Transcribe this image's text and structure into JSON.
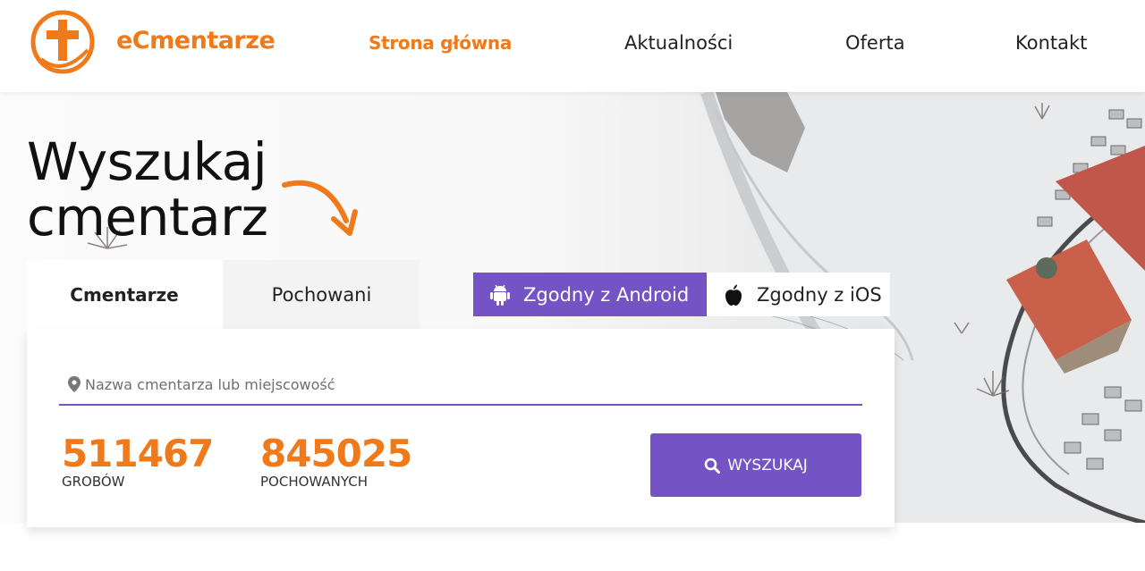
{
  "brand": {
    "name": "eCmentarze",
    "color": "#f07a1a",
    "logo_icon": "cross-in-circle-icon"
  },
  "nav": {
    "items": [
      {
        "label": "Strona główna",
        "active": true
      },
      {
        "label": "Aktualności",
        "active": false
      },
      {
        "label": "Oferta",
        "active": false
      },
      {
        "label": "Kontakt",
        "active": false
      }
    ]
  },
  "hero": {
    "title_line1": "Wyszukaj",
    "title_line2": "cmentarz",
    "arrow_icon": "curved-arrow-icon"
  },
  "tabs": [
    {
      "label": "Cmentarze",
      "active": true
    },
    {
      "label": "Pochowani",
      "active": false
    }
  ],
  "badges": {
    "android": {
      "label": "Zgodny z Android",
      "icon": "android-icon",
      "color": "#7453c5"
    },
    "ios": {
      "label": "Zgodny z iOS",
      "icon": "apple-icon"
    }
  },
  "search": {
    "placeholder": "Nazwa cmentarza lub miejscowość",
    "button_label": "WYSZUKAJ",
    "icon": "location-pin-icon",
    "button_icon": "search-icon"
  },
  "stats": [
    {
      "value": "511467",
      "label": "GROBÓW"
    },
    {
      "value": "845025",
      "label": "POCHOWANYCH"
    }
  ],
  "colors": {
    "accent": "#f07a1a",
    "primary": "#7453c5"
  }
}
